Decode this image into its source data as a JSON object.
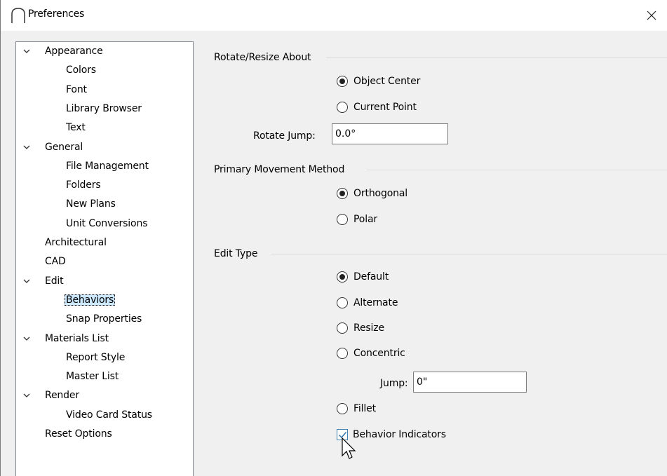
{
  "window": {
    "title": "Preferences",
    "close_glyph": "✕"
  },
  "tree": {
    "items": [
      {
        "label": "Appearance",
        "level": 0,
        "expanded": true
      },
      {
        "label": "Colors",
        "level": 1
      },
      {
        "label": "Font",
        "level": 1
      },
      {
        "label": "Library Browser",
        "level": 1
      },
      {
        "label": "Text",
        "level": 1
      },
      {
        "label": "General",
        "level": 0,
        "expanded": true
      },
      {
        "label": "File Management",
        "level": 1
      },
      {
        "label": "Folders",
        "level": 1
      },
      {
        "label": "New Plans",
        "level": 1
      },
      {
        "label": "Unit Conversions",
        "level": 1
      },
      {
        "label": "Architectural",
        "level": 0
      },
      {
        "label": "CAD",
        "level": 0
      },
      {
        "label": "Edit",
        "level": 0,
        "expanded": true
      },
      {
        "label": "Behaviors",
        "level": 1,
        "selected": true
      },
      {
        "label": "Snap Properties",
        "level": 1
      },
      {
        "label": "Materials List",
        "level": 0,
        "expanded": true
      },
      {
        "label": "Report Style",
        "level": 1
      },
      {
        "label": "Master List",
        "level": 1
      },
      {
        "label": "Render",
        "level": 0,
        "expanded": true
      },
      {
        "label": "Video Card Status",
        "level": 1
      },
      {
        "label": "Reset Options",
        "level": 0
      }
    ]
  },
  "rotate_resize": {
    "group_label": "Rotate/Resize About",
    "object_center": "Object Center",
    "current_point": "Current Point",
    "selected": "Object Center",
    "rotate_jump_label": "Rotate Jump:",
    "rotate_jump_value": "0.0°"
  },
  "movement": {
    "group_label": "Primary Movement Method",
    "orthogonal": "Orthogonal",
    "polar": "Polar",
    "selected": "Orthogonal"
  },
  "edit_type": {
    "group_label": "Edit Type",
    "default": "Default",
    "alternate": "Alternate",
    "resize": "Resize",
    "concentric": "Concentric",
    "jump_label": "Jump:",
    "jump_value": "0\"",
    "fillet": "Fillet",
    "selected": "Default",
    "behavior_indicators": "Behavior Indicators",
    "behavior_indicators_checked": true
  },
  "colors": {
    "selection_bg": "#cce8ff",
    "checkbox_border": "#3c7fb1",
    "checkmark": "#2a6ea8"
  },
  "icons": {
    "app": "arch-icon",
    "close": "close-icon",
    "expand": "chevron-down-icon",
    "cursor": "mouse-pointer-icon"
  }
}
